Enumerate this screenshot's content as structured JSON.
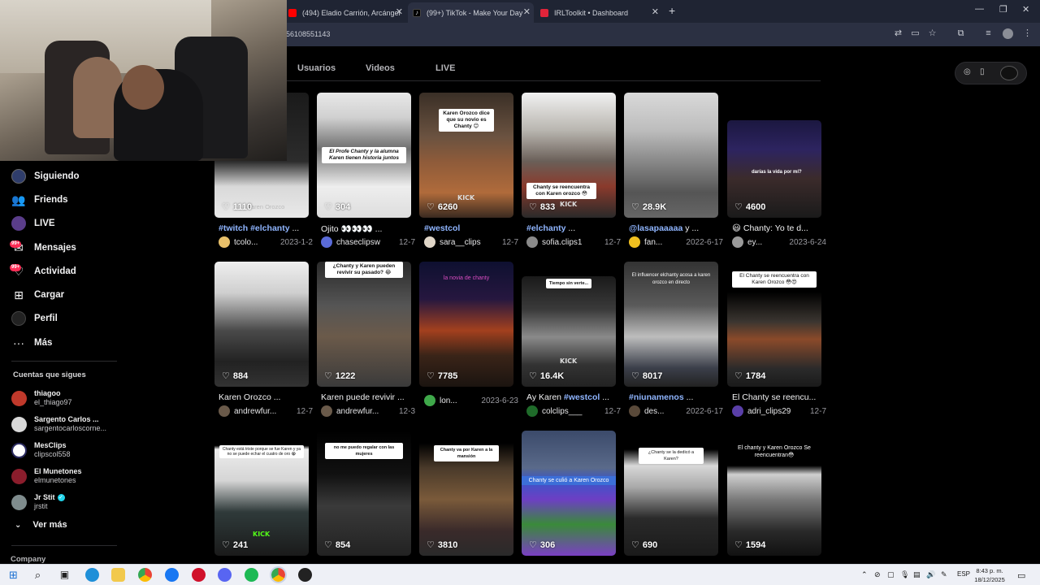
{
  "browser": {
    "tabs": [
      {
        "label": "(494) Eladio Carrión, Arcángel"
      },
      {
        "label": "(99+) TikTok - Make Your Day"
      },
      {
        "label": "IRLToolkit • Dashboard"
      }
    ],
    "url_fragment": "56108551143"
  },
  "sidebar": {
    "items": [
      {
        "label": "Siguiendo",
        "icon": "following-icon"
      },
      {
        "label": "Friends",
        "icon": "friends-icon"
      },
      {
        "label": "LIVE",
        "icon": "live-icon"
      },
      {
        "label": "Mensajes",
        "icon": "messages-icon",
        "badge": "99+"
      },
      {
        "label": "Actividad",
        "icon": "activity-icon",
        "badge": "99+"
      },
      {
        "label": "Cargar",
        "icon": "upload-icon"
      },
      {
        "label": "Perfil",
        "icon": "profile-icon"
      },
      {
        "label": "Más",
        "icon": "more-icon"
      }
    ],
    "following_title": "Cuentas que sigues",
    "following": [
      {
        "name": "thiagoo",
        "handle": "el_thiago97",
        "color": "#c0392b"
      },
      {
        "name": "Sargento Carlos ...",
        "handle": "sargentocarloscorne...",
        "color": "#d9d9d9"
      },
      {
        "name": "MesClips",
        "handle": "clipscol558",
        "color": "#ffffff"
      },
      {
        "name": "El Munetones",
        "handle": "elmunetones",
        "color": "#8b1d2c"
      },
      {
        "name": "Jr Stit",
        "handle": "jrstit",
        "color": "#7f8c8d",
        "verified": true
      }
    ],
    "ver_mas": "Ver más",
    "company": "Company"
  },
  "content_tabs": [
    "Usuarios",
    "Videos",
    "LIVE"
  ],
  "videos": [
    {
      "likes": "1110",
      "title_tag": "#twitch #elchanty",
      "title_rest": " ...",
      "user": "tcolo...",
      "date": "2023-1-2",
      "overlay": "Karen Orozco"
    },
    {
      "likes": "304",
      "title_tag": "",
      "title_rest": "Ojito 👀👀👀 ...",
      "user": "chaseclipsw",
      "date": "12-7",
      "overlay": "El Profe Chanty y la alumna Karen tienen historia juntos"
    },
    {
      "likes": "6260",
      "title_tag": "#westcol",
      "title_rest": "",
      "user": "sara__clips",
      "date": "12-7",
      "overlay": "Karen Orozco dice que su novio es Chanty 😊"
    },
    {
      "likes": "833",
      "title_tag": "#elchanty",
      "title_rest": " ...",
      "user": "sofia.clips1",
      "date": "12-7",
      "overlay": "Chanty se reencuentra con Karen orozco 😳"
    },
    {
      "likes": "28.9K",
      "title_tag": "@lasapaaaaa",
      "title_rest": " y ...",
      "user": "fan...",
      "date": "2022-6-17",
      "overlay": ""
    },
    {
      "likes": "4600",
      "title_tag": "",
      "title_rest": "😃 Chanty: Yo te d...",
      "user": "ey...",
      "date": "2023-6-24",
      "overlay": "darías la vida por mí?"
    },
    {
      "likes": "884",
      "title_tag": "",
      "title_rest": "Karen Orozco ...",
      "user": "andrewfur...",
      "date": "12-7",
      "overlay": ""
    },
    {
      "likes": "1222",
      "title_tag": "",
      "title_rest": "Karen puede revivir ...",
      "user": "andrewfur...",
      "date": "12-3",
      "overlay": "¿Chanty y Karen pueden revivir su pasado? 😂"
    },
    {
      "likes": "7785",
      "title_tag": "",
      "title_rest": "",
      "user": "lon...",
      "date": "2023-6-23",
      "overlay": "la novia de chanty"
    },
    {
      "likes": "16.4K",
      "title_tag": "#westcol",
      "title_rest": "Ay Karen ",
      "user": "colclips___",
      "date": "12-7",
      "overlay": "Tiempo sin verte..."
    },
    {
      "likes": "8017",
      "title_tag": "#niunamenos",
      "title_rest": " ...",
      "user": "des...",
      "date": "2022-6-17",
      "overlay": "El influencer elchanty acosa a karen orozco en directo"
    },
    {
      "likes": "1784",
      "title_tag": "",
      "title_rest": "El Chanty se reencu...",
      "user": "adri_clips29",
      "date": "12-7",
      "overlay": "El Chanty se reencuentra con Karen Orozco 😳😍"
    },
    {
      "likes": "241",
      "title_tag": "",
      "title_rest": "",
      "user": "",
      "date": "",
      "overlay": "Chanty está triste porque se fue Karen y ya no se puede echar el cuatro de oro 😭"
    },
    {
      "likes": "854",
      "title_tag": "",
      "title_rest": "",
      "user": "",
      "date": "",
      "overlay": "no me puedo regalar con las mujeres"
    },
    {
      "likes": "3810",
      "title_tag": "",
      "title_rest": "",
      "user": "",
      "date": "",
      "overlay": "Chanty va por Karen a la mansión"
    },
    {
      "likes": "306",
      "title_tag": "",
      "title_rest": "",
      "user": "",
      "date": "",
      "overlay": "Chanty se culió a Karen Orozco"
    },
    {
      "likes": "690",
      "title_tag": "",
      "title_rest": "",
      "user": "",
      "date": "",
      "overlay": "¿Chanty se la dedicó a Karen?"
    },
    {
      "likes": "1594",
      "title_tag": "",
      "title_rest": "",
      "user": "",
      "date": "",
      "overlay": "El chanty y Karen Orozco Se reencuentran😳"
    }
  ],
  "taskbar": {
    "lang": "ESP",
    "time": "8:43 p. m.",
    "date": "18/12/2025"
  }
}
